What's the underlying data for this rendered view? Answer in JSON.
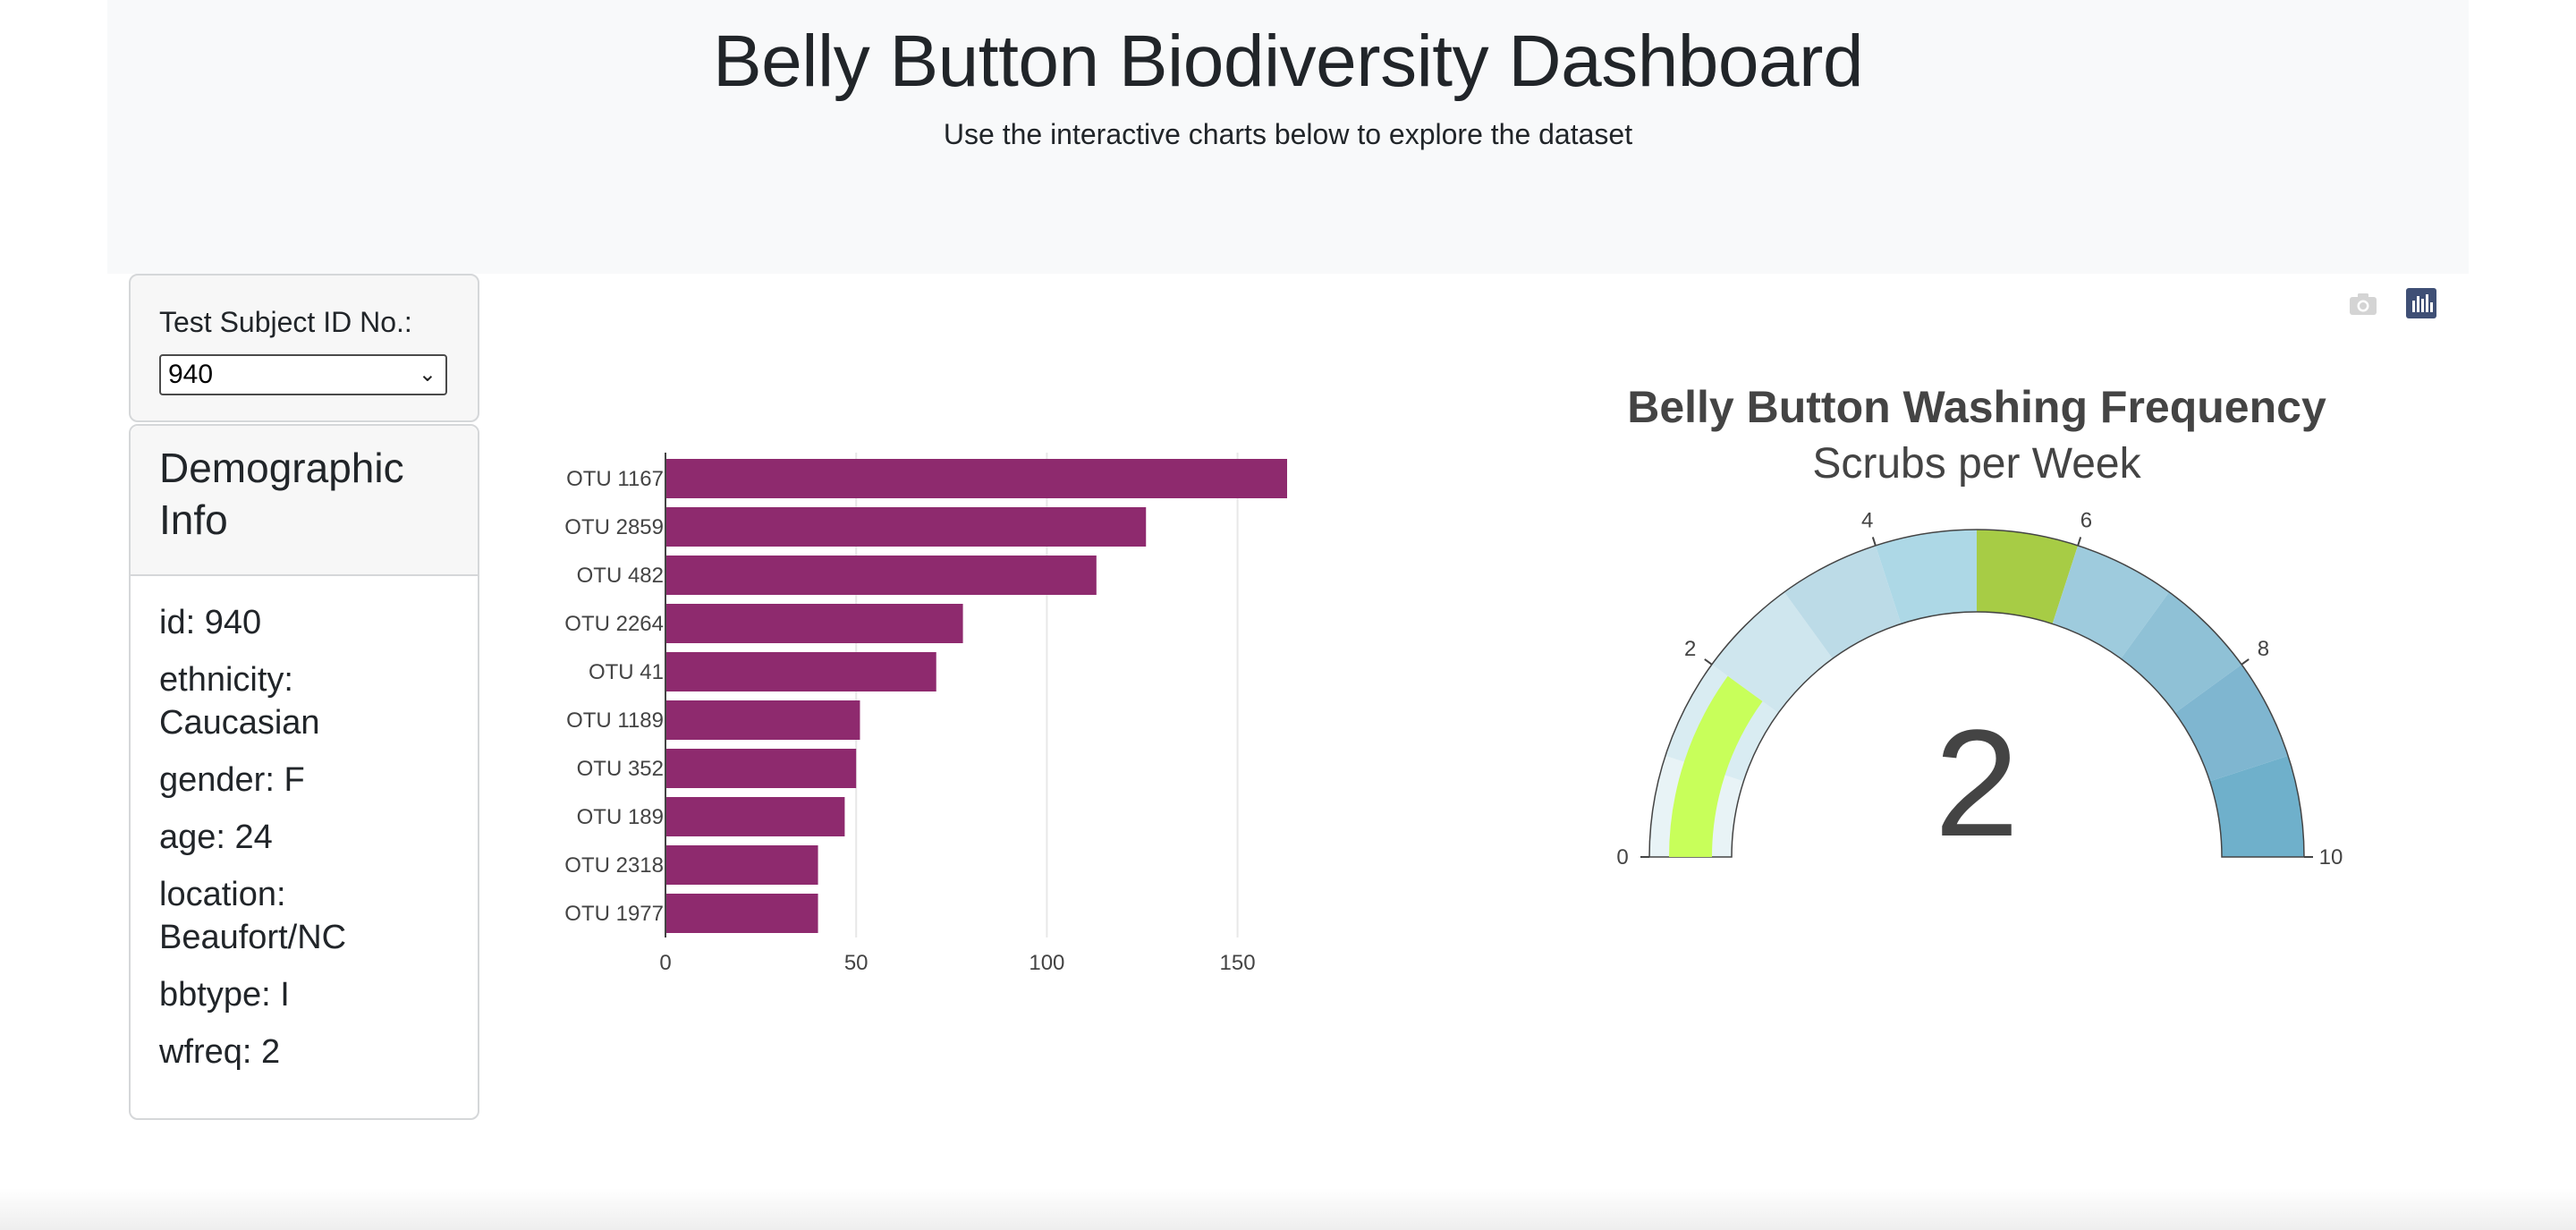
{
  "header": {
    "title": "Belly Button Biodiversity Dashboard",
    "subtitle": "Use the interactive charts below to explore the dataset"
  },
  "selector": {
    "label": "Test Subject ID No.:",
    "selected": "940"
  },
  "demographics": {
    "title": "Demographic Info",
    "rows": [
      "id: 940",
      "ethnicity: Caucasian",
      "gender: F",
      "age: 24",
      "location: Beaufort/NC",
      "bbtype: I",
      "wfreq: 2"
    ]
  },
  "modebar": {
    "icons": [
      "camera-icon",
      "plotly-logo-icon"
    ]
  },
  "chart_data": [
    {
      "type": "bar",
      "orientation": "horizontal",
      "categories": [
        "OTU 1167",
        "OTU 2859",
        "OTU 482",
        "OTU 2264",
        "OTU 41",
        "OTU 1189",
        "OTU 352",
        "OTU 189",
        "OTU 2318",
        "OTU 1977"
      ],
      "values": [
        163,
        126,
        113,
        78,
        71,
        51,
        50,
        47,
        40,
        40
      ],
      "xlim": [
        0,
        163
      ],
      "xticks": [
        0,
        50,
        100,
        150
      ],
      "grid": true,
      "color": "#8e2a6e"
    },
    {
      "type": "gauge",
      "title": "Belly Button Washing Frequency",
      "subtitle": "Scrubs per Week",
      "value": 2,
      "range": [
        0,
        10
      ],
      "ticks": [
        0,
        2,
        4,
        6,
        8,
        10
      ],
      "steps": [
        {
          "range": [
            0,
            1
          ],
          "color": "#e8f3f6"
        },
        {
          "range": [
            1,
            2
          ],
          "color": "#d9ecf2"
        },
        {
          "range": [
            2,
            3
          ],
          "color": "#cfe6ee"
        },
        {
          "range": [
            3,
            4
          ],
          "color": "#bcdbe7"
        },
        {
          "range": [
            4,
            5
          ],
          "color": "#add8e6"
        },
        {
          "range": [
            5,
            6
          ],
          "color": "#a7cc45"
        },
        {
          "range": [
            6,
            7
          ],
          "color": "#9ecbdd"
        },
        {
          "range": [
            7,
            8
          ],
          "color": "#8fc1d6"
        },
        {
          "range": [
            8,
            9
          ],
          "color": "#7fb6d0"
        },
        {
          "range": [
            9,
            10
          ],
          "color": "#6fb0cb"
        }
      ],
      "bar_color": "#c8ff5a"
    }
  ]
}
